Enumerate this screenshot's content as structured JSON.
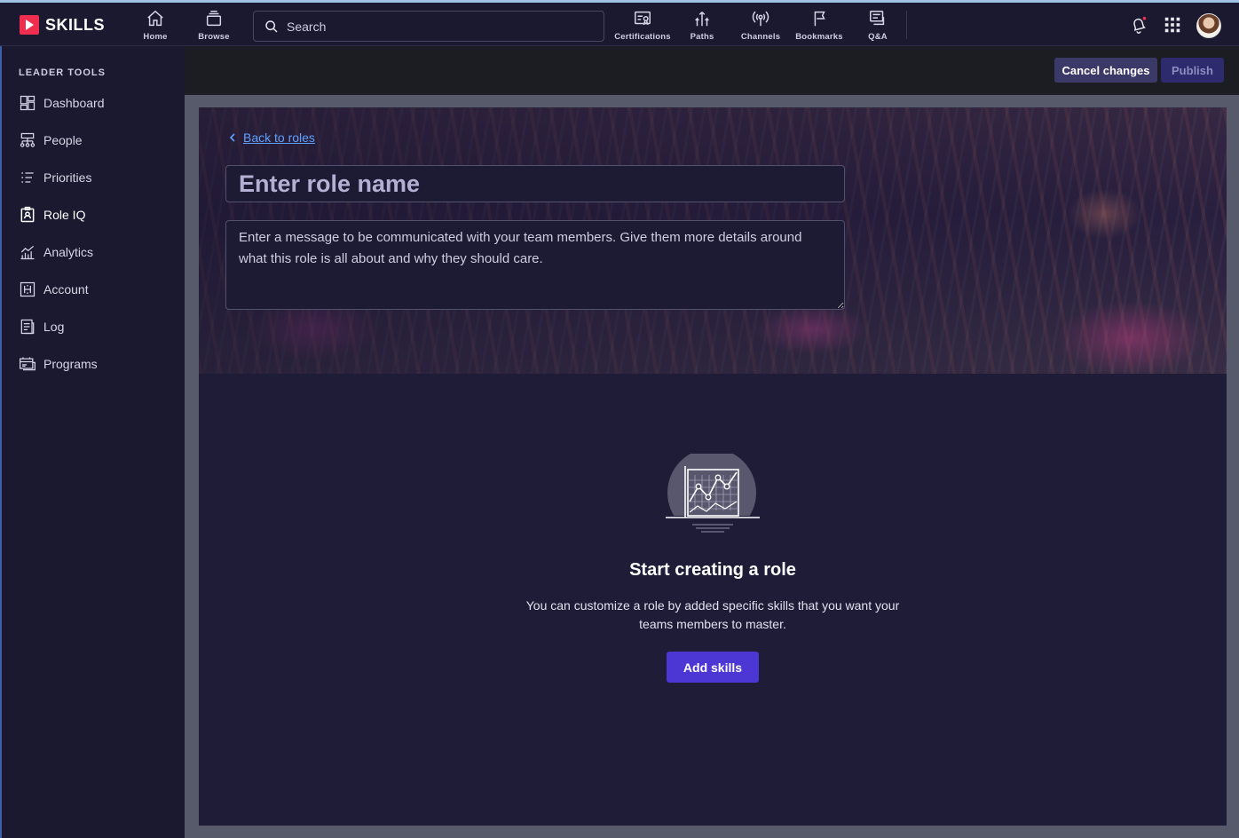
{
  "app": {
    "logo_text": "SKILLS",
    "brand_color": "#ef2e4f",
    "accent_color": "#4c36d4"
  },
  "topnav": {
    "items": [
      {
        "label": "Home",
        "icon": "home-icon"
      },
      {
        "label": "Browse",
        "icon": "browse-icon"
      },
      {
        "label": "Certifications",
        "icon": "certifications-icon"
      },
      {
        "label": "Paths",
        "icon": "paths-icon"
      },
      {
        "label": "Channels",
        "icon": "channels-icon"
      },
      {
        "label": "Bookmarks",
        "icon": "bookmarks-icon"
      },
      {
        "label": "Q&A",
        "icon": "qa-icon"
      }
    ],
    "search_placeholder": "Search",
    "right_icons": [
      "notifications-icon",
      "apps-grid-icon",
      "user-avatar"
    ]
  },
  "sidebar": {
    "heading": "LEADER TOOLS",
    "items": [
      {
        "label": "Dashboard",
        "icon": "dashboard-icon"
      },
      {
        "label": "People",
        "icon": "people-icon"
      },
      {
        "label": "Priorities",
        "icon": "priorities-icon"
      },
      {
        "label": "Role IQ",
        "icon": "role-iq-icon",
        "active": true
      },
      {
        "label": "Analytics",
        "icon": "analytics-icon"
      },
      {
        "label": "Account",
        "icon": "account-icon"
      },
      {
        "label": "Log",
        "icon": "log-icon"
      },
      {
        "label": "Programs",
        "icon": "programs-icon"
      }
    ]
  },
  "actions": {
    "cancel_label": "Cancel changes",
    "publish_label": "Publish"
  },
  "editor": {
    "back_label": "Back to roles",
    "role_name_placeholder": "Enter role name",
    "message_placeholder": "Enter a message to be communicated with your team members. Give them more details around what this role is all about and why they should care."
  },
  "empty_state": {
    "icon": "chart-board-icon",
    "title": "Start creating a role",
    "description": "You can customize a role by added specific skills that you want your teams members to master.",
    "button_label": "Add skills"
  }
}
